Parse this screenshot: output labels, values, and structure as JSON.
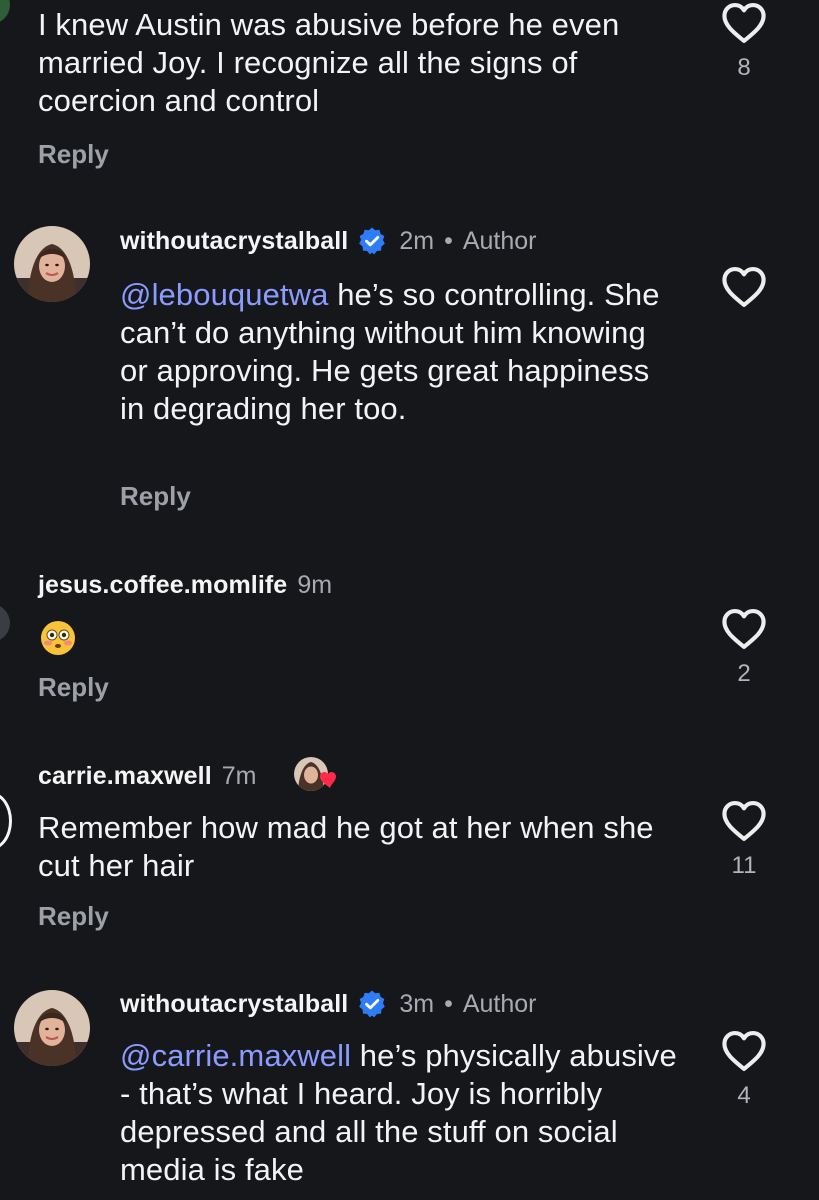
{
  "comments": [
    {
      "body": "I knew Austin was abusive before he even married Joy. I recognize all the signs of coercion and control",
      "reply_label": "Reply",
      "like_count": "8"
    },
    {
      "username": "withoutacrystalball",
      "verified": true,
      "time": "2m",
      "separator": "•",
      "author_label": "Author",
      "mention": "@lebouquetwa",
      "body": " he’s so controlling. She can’t do anything without him knowing or approving. He gets great happiness in degrading her too.",
      "reply_label": "Reply",
      "like_count": ""
    },
    {
      "username": "jesus.coffee.momlife",
      "time": "9m",
      "emoji": "flushed-face",
      "reply_label": "Reply",
      "like_count": "2"
    },
    {
      "username": "carrie.maxwell",
      "time": "7m",
      "liked_by_author": true,
      "body": "Remember how mad he got at her when she cut her hair",
      "reply_label": "Reply",
      "like_count": "11"
    },
    {
      "username": "withoutacrystalball",
      "verified": true,
      "time": "3m",
      "separator": "•",
      "author_label": "Author",
      "mention": "@carrie.maxwell",
      "body": " he’s physically abusive - that’s what I heard. Joy is horribly depressed and all the stuff on social media is fake",
      "reply_label": "",
      "like_count": "4"
    }
  ],
  "colors": {
    "background": "#15171b",
    "text": "#f2f3f5",
    "muted": "#a8aab0",
    "mention": "#8b9bff",
    "verified": "#2f7df6"
  },
  "icons": {
    "like": "heart-outline-icon",
    "verified": "verified-badge-icon"
  }
}
